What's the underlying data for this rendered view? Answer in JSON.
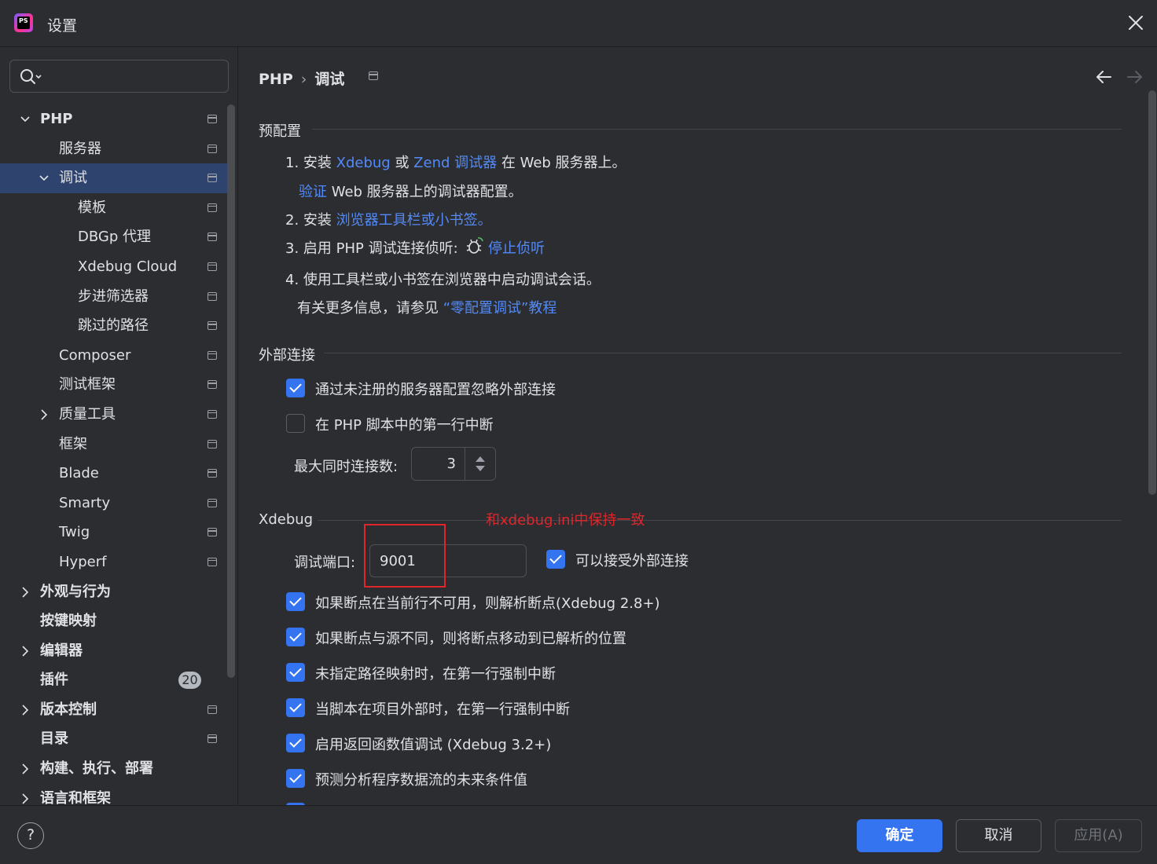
{
  "window": {
    "title": "设置"
  },
  "search": {
    "placeholder": ""
  },
  "sidebar": {
    "items": [
      {
        "label": "PHP",
        "level": 0,
        "expand": "open",
        "bold": true,
        "pin": true
      },
      {
        "label": "服务器",
        "level": 1,
        "pin": true
      },
      {
        "label": "调试",
        "level": 1,
        "expand": "open",
        "selected": true,
        "pin": true
      },
      {
        "label": "模板",
        "level": 2,
        "pin": true
      },
      {
        "label": "DBGp 代理",
        "level": 2,
        "pin": true
      },
      {
        "label": "Xdebug Cloud",
        "level": 2,
        "pin": true
      },
      {
        "label": "步进筛选器",
        "level": 2,
        "pin": true
      },
      {
        "label": "跳过的路径",
        "level": 2,
        "pin": true
      },
      {
        "label": "Composer",
        "level": 1,
        "pin": true
      },
      {
        "label": "测试框架",
        "level": 1,
        "pin": true
      },
      {
        "label": "质量工具",
        "level": 1,
        "expand": "closed",
        "pin": true
      },
      {
        "label": "框架",
        "level": 1,
        "pin": true
      },
      {
        "label": "Blade",
        "level": 1,
        "pin": true
      },
      {
        "label": "Smarty",
        "level": 1,
        "pin": true
      },
      {
        "label": "Twig",
        "level": 1,
        "pin": true
      },
      {
        "label": "Hyperf",
        "level": 1,
        "pin": true
      },
      {
        "label": "外观与行为",
        "level": 0,
        "expand": "closed",
        "bold": true
      },
      {
        "label": "按键映射",
        "level": 0,
        "bold": true
      },
      {
        "label": "编辑器",
        "level": 0,
        "expand": "closed",
        "bold": true
      },
      {
        "label": "插件",
        "level": 0,
        "bold": true,
        "badge": "20"
      },
      {
        "label": "版本控制",
        "level": 0,
        "expand": "closed",
        "bold": true,
        "pin": true
      },
      {
        "label": "目录",
        "level": 0,
        "bold": true,
        "pin": true
      },
      {
        "label": "构建、执行、部署",
        "level": 0,
        "expand": "closed",
        "bold": true
      },
      {
        "label": "语言和框架",
        "level": 0,
        "expand": "closed",
        "bold": true
      }
    ]
  },
  "breadcrumb": {
    "parent": "PHP",
    "current": "调试"
  },
  "preconfig": {
    "title": "预配置",
    "step1_prefix": "1. 安装 ",
    "step1_xdebug": "Xdebug",
    "step1_or": " 或 ",
    "step1_zend": "Zend 调试器",
    "step1_suffix": " 在 Web 服务器上。",
    "verify_link": "验证",
    "verify_suffix": " Web 服务器上的调试器配置。",
    "step2_prefix": "2. 安装 ",
    "step2_link": "浏览器工具栏或小书签。",
    "step3_prefix": "3. 启用 PHP 调试连接侦听:",
    "step3_link": "停止侦听",
    "step4": "4. 使用工具栏或小书签在浏览器中启动调试会话。",
    "more_prefix": "有关更多信息，请参见 ",
    "more_link": "“零配置调试”教程"
  },
  "external": {
    "title": "外部连接",
    "ignore_label": "通过未注册的服务器配置忽略外部连接",
    "ignore_checked": true,
    "break_first_label": "在 PHP 脚本中的第一行中断",
    "break_first_checked": false,
    "max_conn_label": "最大同时连接数:",
    "max_conn_value": "3"
  },
  "xdebug": {
    "title": "Xdebug",
    "port_label": "调试端口:",
    "port_value": "9001",
    "accept_label": "可以接受外部连接",
    "accept_checked": true,
    "annotation": "和xdebug.ini中保持一致",
    "options": [
      {
        "label": "如果断点在当前行不可用，则解析断点(Xdebug 2.8+)",
        "checked": true
      },
      {
        "label": "如果断点与源不同，则将断点移动到已解析的位置",
        "checked": true
      },
      {
        "label": "未指定路径映射时，在第一行强制中断",
        "checked": true
      },
      {
        "label": "当脚本在项目外部时，在第一行强制中断",
        "checked": true
      },
      {
        "label": "启用返回函数值调试 (Xdebug 3.2+)",
        "checked": true
      },
      {
        "label": "预测分析程序数据流的未来条件值",
        "checked": true
      }
    ]
  },
  "footer": {
    "help": "?",
    "ok": "确定",
    "cancel": "取消",
    "apply": "应用(A)"
  },
  "colors": {
    "background": "#2b2d30",
    "accent": "#3574f0",
    "link": "#548af7",
    "selection": "#2e436e",
    "annotation": "#e0262b"
  }
}
